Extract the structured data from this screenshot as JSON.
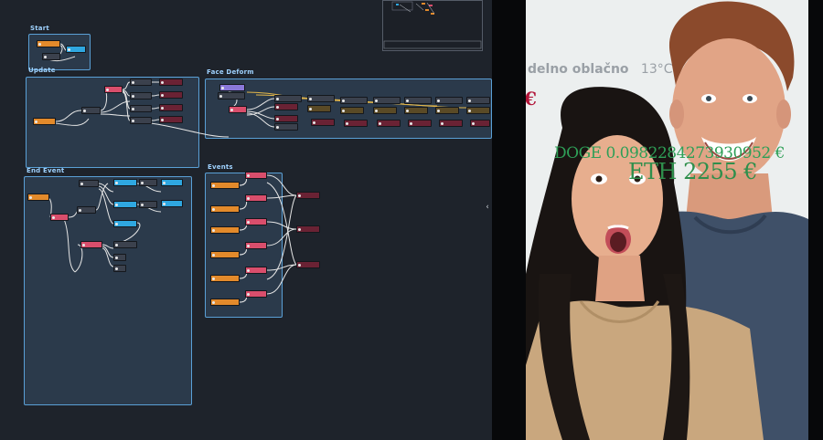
{
  "graph": {
    "groups": {
      "start": "Start",
      "update": "Update",
      "face_deform": "Face Deform",
      "end_event": "End Event",
      "events": "Events"
    }
  },
  "preview": {
    "weather_location": "delno oblačno",
    "weather_temp": "13°C",
    "euro_symbol": "€",
    "doge_ticker": "DOGE 0.0982284273930952 €",
    "eth_ticker": "ETH 2255 €"
  },
  "colors": {
    "graph_background": "#1e232b",
    "group_fill": "#2b3a4b",
    "group_border": "#5aa0d6",
    "node_orange": "#e38a2b",
    "node_pink": "#d94e6c",
    "node_wine": "#6a2234",
    "node_blue": "#2fa7e0",
    "wire": "#e6e6e6",
    "wire_yellow": "#e2b64a",
    "euro_red": "#b2163a",
    "ticker_green": "#2e9f57"
  },
  "icons": [
    "collapse-arrow-icon"
  ]
}
